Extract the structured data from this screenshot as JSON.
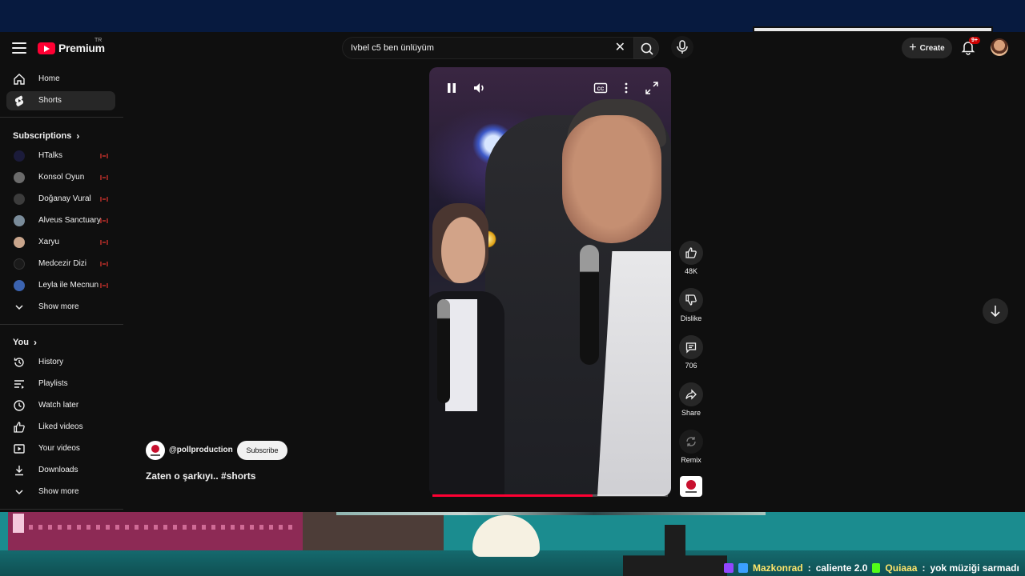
{
  "masthead": {
    "logo_text": "Premium",
    "logo_tm": "TR",
    "search_query": "Ivbel c5 ben ünlüyüm",
    "create_label": "Create",
    "notification_badge": "9+",
    "icons": [
      "menu-icon",
      "search-icon",
      "clear-icon",
      "mic-icon",
      "plus-icon",
      "bell-icon"
    ]
  },
  "sidebar": {
    "main": [
      {
        "label": "Home",
        "icon": "home-icon"
      },
      {
        "label": "Shorts",
        "icon": "shorts-icon",
        "active": true
      }
    ],
    "subscriptions_title": "Subscriptions",
    "subscriptions": [
      {
        "label": "HTalks"
      },
      {
        "label": "Konsol Oyun"
      },
      {
        "label": "Doğanay Vural"
      },
      {
        "label": "Alveus Sanctuary"
      },
      {
        "label": "Xaryu"
      },
      {
        "label": "Medcezir Dizi"
      },
      {
        "label": "Leyla ile Mecnun"
      }
    ],
    "show_more": "Show more",
    "you_title": "You",
    "you_items": [
      {
        "label": "History",
        "icon": "history-icon"
      },
      {
        "label": "Playlists",
        "icon": "playlists-icon"
      },
      {
        "label": "Watch later",
        "icon": "clock-icon"
      },
      {
        "label": "Liked videos",
        "icon": "thumbs-up-icon"
      },
      {
        "label": "Your videos",
        "icon": "your-videos-icon"
      },
      {
        "label": "Downloads",
        "icon": "download-icon"
      }
    ],
    "show_more_2": "Show more"
  },
  "short": {
    "channel_handle": "@pollproduction",
    "subscribe_label": "Subscribe",
    "title": "Zaten o şarkıyı.. #shorts",
    "progress": 0.68,
    "actions": {
      "like_count": "48K",
      "dislike_label": "Dislike",
      "comment_count": "706",
      "share_label": "Share",
      "remix_label": "Remix"
    }
  },
  "stream_overlay": {
    "chat": [
      {
        "user": "Mazkonrad",
        "message": "caliente 2.0"
      },
      {
        "user": "Quiaaa",
        "message": "yok müziği sarmadı"
      }
    ],
    "colors": {
      "teal": "#1b8c8f",
      "pink": "#8d2a55",
      "navy": "#071a3f"
    }
  }
}
